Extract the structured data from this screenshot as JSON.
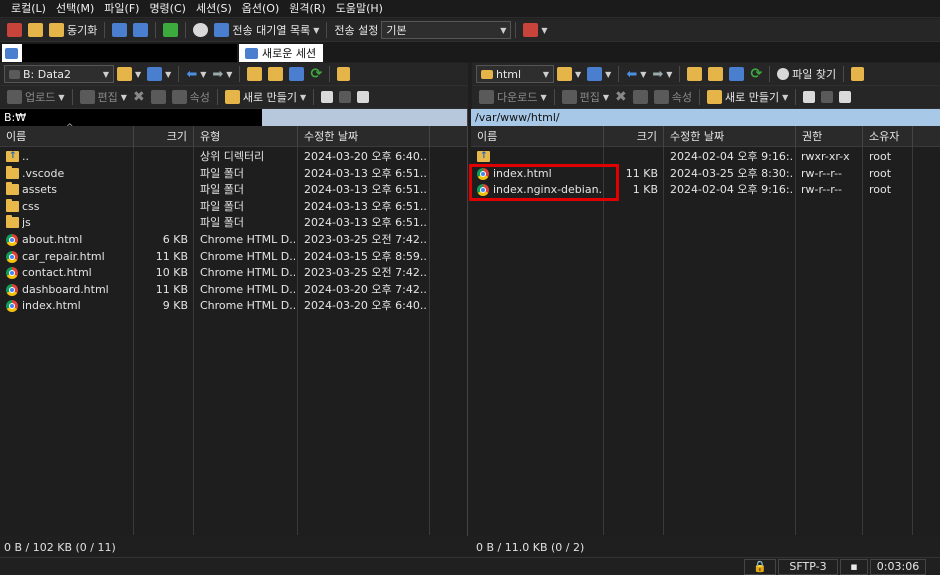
{
  "menu": [
    "로컬(L)",
    "선택(M)",
    "파일(F)",
    "명령(C)",
    "세션(S)",
    "옵션(O)",
    "원격(R)",
    "도움말(H)"
  ],
  "toolbar1": {
    "sync": "동기화",
    "queue": "전송 대기열 목록",
    "transfer_settings_label": "전송 설정",
    "transfer_settings_value": "기본"
  },
  "tabs": {
    "new_session": "새로운 세션"
  },
  "left": {
    "drive": "B: Data2",
    "upload": "업로드",
    "edit": "편집",
    "properties": "속성",
    "new": "새로 만들기",
    "path": "B:₩",
    "columns": [
      "이름",
      "크기",
      "유형",
      "수정한 날짜"
    ],
    "files": [
      {
        "name": "..",
        "size": "",
        "type": "상위 디렉터리",
        "date": "2024-03-20  오후 6:40...",
        "icon": "up-folder-icon"
      },
      {
        "name": ".vscode",
        "size": "",
        "type": "파일 폴더",
        "date": "2024-03-13  오후 6:51...",
        "icon": "folder-icon"
      },
      {
        "name": "assets",
        "size": "",
        "type": "파일 폴더",
        "date": "2024-03-13  오후 6:51...",
        "icon": "folder-icon"
      },
      {
        "name": "css",
        "size": "",
        "type": "파일 폴더",
        "date": "2024-03-13  오후 6:51...",
        "icon": "folder-icon"
      },
      {
        "name": "js",
        "size": "",
        "type": "파일 폴더",
        "date": "2024-03-13  오후 6:51...",
        "icon": "folder-icon"
      },
      {
        "name": "about.html",
        "size": "6 KB",
        "type": "Chrome HTML D...",
        "date": "2023-03-25  오전 7:42...",
        "icon": "chrome-icon"
      },
      {
        "name": "car_repair.html",
        "size": "11 KB",
        "type": "Chrome HTML D...",
        "date": "2024-03-15  오후 8:59...",
        "icon": "chrome-icon"
      },
      {
        "name": "contact.html",
        "size": "10 KB",
        "type": "Chrome HTML D...",
        "date": "2023-03-25  오전 7:42...",
        "icon": "chrome-icon"
      },
      {
        "name": "dashboard.html",
        "size": "11 KB",
        "type": "Chrome HTML D...",
        "date": "2024-03-20  오후 7:42...",
        "icon": "chrome-icon"
      },
      {
        "name": "index.html",
        "size": "9 KB",
        "type": "Chrome HTML D...",
        "date": "2024-03-20  오후 6:40...",
        "icon": "chrome-icon"
      }
    ],
    "status": "0 B / 102 KB (0 / 11)"
  },
  "right": {
    "dir": "html",
    "download": "다운로드",
    "edit": "편집",
    "properties": "속성",
    "new": "새로 만들기",
    "find": "파일 찾기",
    "path": "/var/www/html/",
    "columns": [
      "이름",
      "크기",
      "수정한 날짜",
      "권한",
      "소유자"
    ],
    "files": [
      {
        "name": "",
        "size": "",
        "date": "2024-02-04  오후 9:16:...",
        "perm": "rwxr-xr-x",
        "owner": "root",
        "icon": "up-folder-icon"
      },
      {
        "name": "index.html",
        "size": "11 KB",
        "date": "2024-03-25  오후 8:30:...",
        "perm": "rw-r--r--",
        "owner": "root",
        "icon": "chrome-icon"
      },
      {
        "name": "index.nginx-debian.h...",
        "size": "1 KB",
        "date": "2024-02-04  오후 9:16:...",
        "perm": "rw-r--r--",
        "owner": "root",
        "icon": "chrome-icon"
      }
    ],
    "status": "0 B / 11.0 KB (0 / 2)"
  },
  "bottom": {
    "protocol": "SFTP-3",
    "time": "0:03:06"
  },
  "colors": {
    "accent": "#a8c8e8",
    "highlight": "#e00000"
  }
}
